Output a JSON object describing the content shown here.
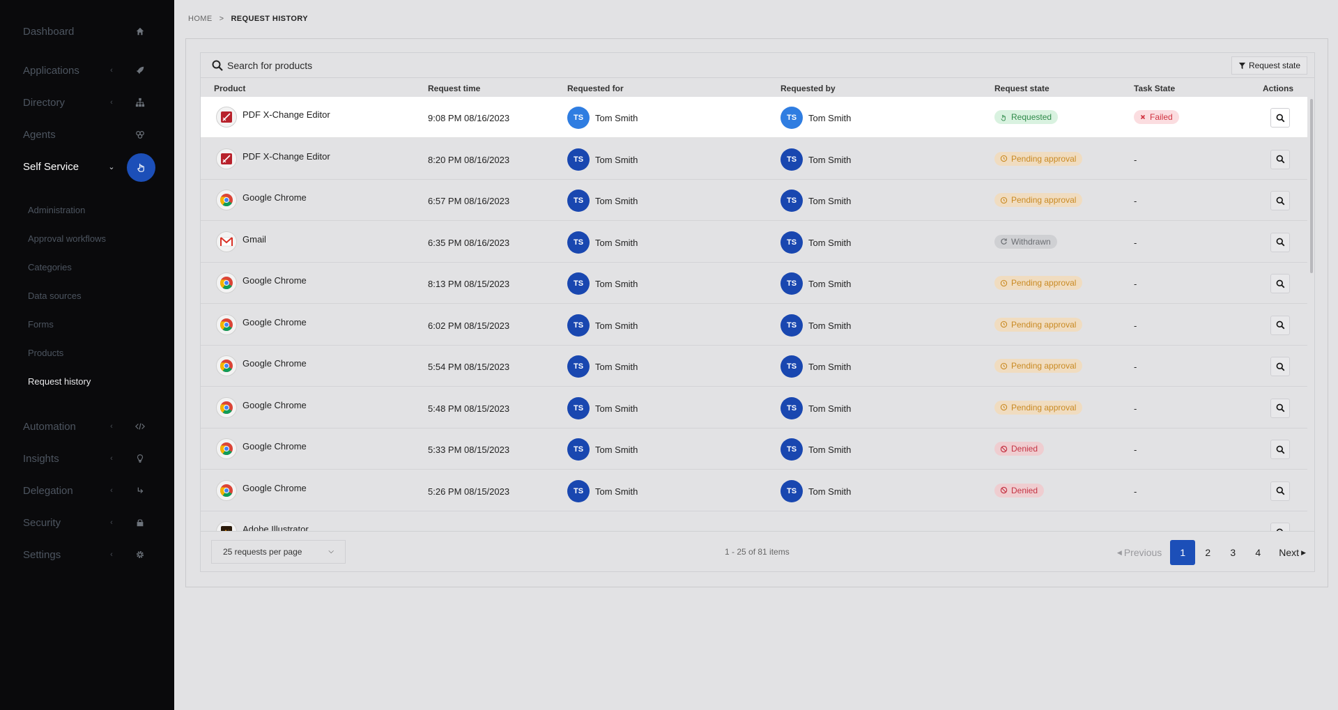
{
  "sidebar": {
    "items": [
      {
        "label": "Dashboard",
        "icon": "home-icon"
      },
      {
        "label": "Applications",
        "icon": "rocket-icon"
      },
      {
        "label": "Directory",
        "icon": "sitemap-icon"
      },
      {
        "label": "Agents",
        "icon": "agents-icon"
      },
      {
        "label": "Self Service",
        "icon": "hand-pointer-icon"
      },
      {
        "label": "Automation",
        "icon": "code-icon"
      },
      {
        "label": "Insights",
        "icon": "lightbulb-icon"
      },
      {
        "label": "Delegation",
        "icon": "delegation-icon"
      },
      {
        "label": "Security",
        "icon": "lock-icon"
      },
      {
        "label": "Settings",
        "icon": "gear-icon"
      }
    ],
    "subitems": [
      "Administration",
      "Approval workflows",
      "Categories",
      "Data sources",
      "Forms",
      "Products",
      "Request history"
    ]
  },
  "breadcrumb": {
    "home": "HOME",
    "separator": ">",
    "current": "REQUEST HISTORY"
  },
  "search": {
    "placeholder": "Search for products"
  },
  "filter": {
    "label": "Request state"
  },
  "columns": {
    "product": "Product",
    "request_time": "Request time",
    "requested_for": "Requested for",
    "requested_by": "Requested by",
    "request_state": "Request state",
    "task_state": "Task State",
    "actions": "Actions"
  },
  "rows": [
    {
      "product": "PDF X-Change Editor",
      "icon": "pdf",
      "time": "9:08 PM 08/16/2023",
      "for_initials": "TS",
      "for": "Tom Smith",
      "by_initials": "TS",
      "by": "Tom Smith",
      "state": "Requested",
      "task": "Failed"
    },
    {
      "product": "PDF X-Change Editor",
      "icon": "pdf",
      "time": "8:20 PM 08/16/2023",
      "for_initials": "TS",
      "for": "Tom Smith",
      "by_initials": "TS",
      "by": "Tom Smith",
      "state": "Pending approval",
      "task": "-"
    },
    {
      "product": "Google Chrome",
      "icon": "chrome",
      "time": "6:57 PM 08/16/2023",
      "for_initials": "TS",
      "for": "Tom Smith",
      "by_initials": "TS",
      "by": "Tom Smith",
      "state": "Pending approval",
      "task": "-"
    },
    {
      "product": "Gmail",
      "icon": "gmail",
      "time": "6:35 PM 08/16/2023",
      "for_initials": "TS",
      "for": "Tom Smith",
      "by_initials": "TS",
      "by": "Tom Smith",
      "state": "Withdrawn",
      "task": "-"
    },
    {
      "product": "Google Chrome",
      "icon": "chrome",
      "time": "8:13 PM 08/15/2023",
      "for_initials": "TS",
      "for": "Tom Smith",
      "by_initials": "TS",
      "by": "Tom Smith",
      "state": "Pending approval",
      "task": "-"
    },
    {
      "product": "Google Chrome",
      "icon": "chrome",
      "time": "6:02 PM 08/15/2023",
      "for_initials": "TS",
      "for": "Tom Smith",
      "by_initials": "TS",
      "by": "Tom Smith",
      "state": "Pending approval",
      "task": "-"
    },
    {
      "product": "Google Chrome",
      "icon": "chrome",
      "time": "5:54 PM 08/15/2023",
      "for_initials": "TS",
      "for": "Tom Smith",
      "by_initials": "TS",
      "by": "Tom Smith",
      "state": "Pending approval",
      "task": "-"
    },
    {
      "product": "Google Chrome",
      "icon": "chrome",
      "time": "5:48 PM 08/15/2023",
      "for_initials": "TS",
      "for": "Tom Smith",
      "by_initials": "TS",
      "by": "Tom Smith",
      "state": "Pending approval",
      "task": "-"
    },
    {
      "product": "Google Chrome",
      "icon": "chrome",
      "time": "5:33 PM 08/15/2023",
      "for_initials": "TS",
      "for": "Tom Smith",
      "by_initials": "TS",
      "by": "Tom Smith",
      "state": "Denied",
      "task": "-"
    },
    {
      "product": "Google Chrome",
      "icon": "chrome",
      "time": "5:26 PM 08/15/2023",
      "for_initials": "TS",
      "for": "Tom Smith",
      "by_initials": "TS",
      "by": "Tom Smith",
      "state": "Denied",
      "task": "-"
    },
    {
      "product": "Adobe Illustrator",
      "icon": "adobe",
      "time": "",
      "for_initials": "",
      "for": "",
      "by_initials": "",
      "by": "",
      "state": "",
      "task": ""
    }
  ],
  "footer": {
    "per_page": "25 requests per page",
    "range": "1 - 25 of 81 items",
    "prev": "Previous",
    "next": "Next",
    "pages": [
      "1",
      "2",
      "3",
      "4"
    ],
    "current_page": "1"
  },
  "colors": {
    "accent": "#1c4fb8",
    "sidebar_bg": "#0a0a0c",
    "avatar_highlight": "#2f7de1"
  }
}
